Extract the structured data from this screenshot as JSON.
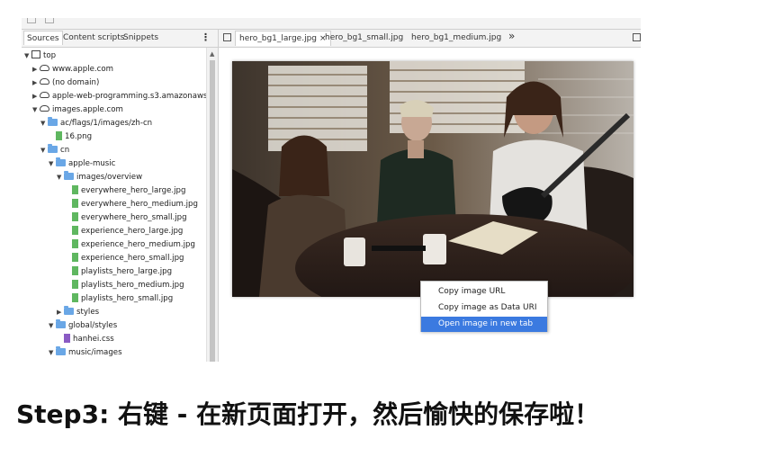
{
  "devtools": {
    "left_tabs": [
      "Sources",
      "Content scripts",
      "Snippets"
    ],
    "tree": [
      {
        "label": "top",
        "type": "frame",
        "depth": 0,
        "open": true
      },
      {
        "label": "www.apple.com",
        "type": "cloud",
        "depth": 1,
        "open": false
      },
      {
        "label": "(no domain)",
        "type": "cloud",
        "depth": 1,
        "open": false
      },
      {
        "label": "apple-web-programming.s3.amazonaws.co",
        "type": "cloud",
        "depth": 1,
        "open": false
      },
      {
        "label": "images.apple.com",
        "type": "cloud",
        "depth": 1,
        "open": true
      },
      {
        "label": "ac/flags/1/images/zh-cn",
        "type": "folder",
        "depth": 2,
        "open": true
      },
      {
        "label": "16.png",
        "type": "img",
        "depth": 3
      },
      {
        "label": "cn",
        "type": "folder",
        "depth": 2,
        "open": true
      },
      {
        "label": "apple-music",
        "type": "folder",
        "depth": 3,
        "open": true
      },
      {
        "label": "images/overview",
        "type": "folder",
        "depth": 4,
        "open": true
      },
      {
        "label": "everywhere_hero_large.jpg",
        "type": "img",
        "depth": 5
      },
      {
        "label": "everywhere_hero_medium.jpg",
        "type": "img",
        "depth": 5
      },
      {
        "label": "everywhere_hero_small.jpg",
        "type": "img",
        "depth": 5
      },
      {
        "label": "experience_hero_large.jpg",
        "type": "img",
        "depth": 5
      },
      {
        "label": "experience_hero_medium.jpg",
        "type": "img",
        "depth": 5
      },
      {
        "label": "experience_hero_small.jpg",
        "type": "img",
        "depth": 5
      },
      {
        "label": "playlists_hero_large.jpg",
        "type": "img",
        "depth": 5
      },
      {
        "label": "playlists_hero_medium.jpg",
        "type": "img",
        "depth": 5
      },
      {
        "label": "playlists_hero_small.jpg",
        "type": "img",
        "depth": 5
      },
      {
        "label": "styles",
        "type": "folder",
        "depth": 4,
        "open": false
      },
      {
        "label": "global/styles",
        "type": "folder",
        "depth": 3,
        "open": true
      },
      {
        "label": "hanhei.css",
        "type": "css",
        "depth": 4
      },
      {
        "label": "music/images",
        "type": "folder",
        "depth": 3,
        "open": true
      }
    ],
    "file_tabs": [
      {
        "label": "hero_bg1_large.jpg",
        "active": true,
        "close": "×"
      },
      {
        "label": "hero_bg1_small.jpg",
        "active": false
      },
      {
        "label": "hero_bg1_medium.jpg",
        "active": false
      }
    ],
    "more_tabs": "»"
  },
  "context_menu": {
    "items": [
      {
        "label": "Copy image URL",
        "highlighted": false
      },
      {
        "label": "Copy image as Data URI",
        "highlighted": false
      },
      {
        "label": "Open image in new tab",
        "highlighted": true
      }
    ],
    "highlight_color": "#3b7ae0"
  },
  "caption": "Step3: 右键 - 在新页面打开，然后愉快的保存啦！"
}
